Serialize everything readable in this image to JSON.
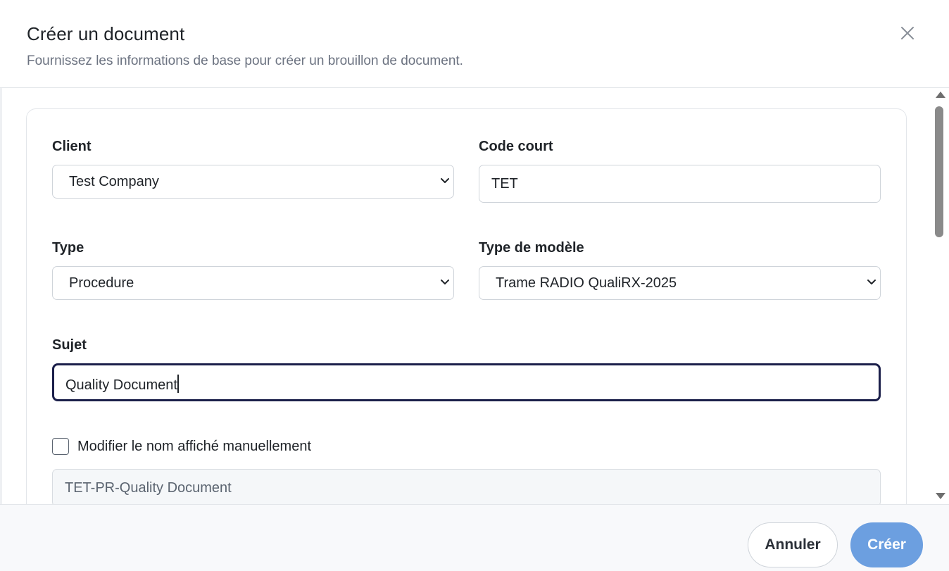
{
  "dialog": {
    "title": "Créer un document",
    "subtitle": "Fournissez les informations de base pour créer un brouillon de document.",
    "close_icon": "close-icon"
  },
  "form": {
    "client": {
      "label": "Client",
      "value": "Test Company"
    },
    "code_court": {
      "label": "Code court",
      "value": "TET"
    },
    "type": {
      "label": "Type",
      "value": "Procedure"
    },
    "type_modele": {
      "label": "Type de modèle",
      "value": "Trame RADIO QualiRX-2025"
    },
    "sujet": {
      "label": "Sujet",
      "value": "Quality Document"
    },
    "manual_name": {
      "label": "Modifier le nom affiché manuellement",
      "checked": false
    },
    "display_name": {
      "value": "TET-PR-Quality Document"
    }
  },
  "footer": {
    "cancel_label": "Annuler",
    "create_label": "Créer"
  },
  "colors": {
    "primary": "#6c9fe0",
    "focus_border": "#1b1f4a",
    "text": "#1f2328",
    "muted": "#6b7280"
  }
}
